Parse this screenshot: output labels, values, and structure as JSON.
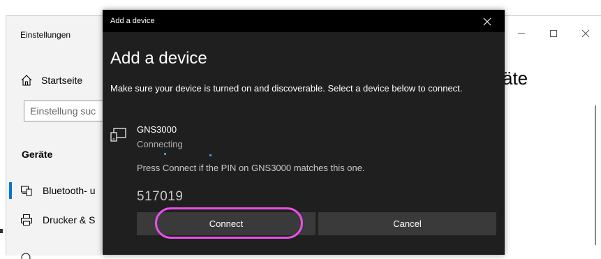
{
  "settings": {
    "window_title": "Einstellungen",
    "home_label": "Startseite",
    "search_placeholder": "Einstellung suc",
    "section_header": "Geräte",
    "nav_items": [
      {
        "label": "Bluetooth- u",
        "icon": "bluetooth-devices-icon"
      },
      {
        "label": "Drucker & S",
        "icon": "printer-icon"
      }
    ],
    "page_heading": "äte",
    "window_controls": [
      "minimize",
      "maximize",
      "close"
    ]
  },
  "dialog": {
    "titlebar": "Add a device",
    "heading": "Add a device",
    "description": "Make sure your device is turned on and discoverable. Select a device below to connect.",
    "device": {
      "name": "GNS3000",
      "status": "Connecting",
      "icon": "device-icon"
    },
    "pin_hint": "Press Connect if the PIN on GNS3000 matches this one.",
    "pin": "517019",
    "buttons": {
      "connect": "Connect",
      "cancel": "Cancel"
    }
  },
  "colors": {
    "dialog_bg": "#1f1f1f",
    "titlebar_bg": "#000000",
    "button_bg": "#3a3a3a",
    "highlight": "#e94fe9",
    "accent": "#0078d4"
  }
}
